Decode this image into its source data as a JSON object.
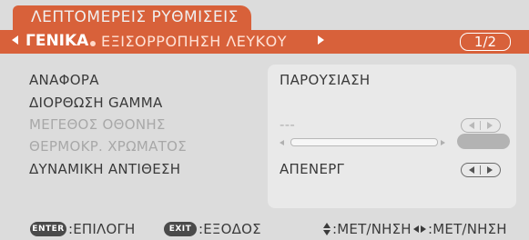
{
  "window": {
    "title": "ΛΕΠΤΟΜΕΡΕΙΣ ΡΥΘΜΙΣΕΙΣ"
  },
  "tabs": {
    "active": "ΓΕΝΙΚΑ",
    "inactive": "ΕΞΙΣΟΡΡΟΠΗΣΗ ΛΕΥΚΟΥ",
    "page": "1/2",
    "left_icon": "triangle-left-icon",
    "right_icon": "triangle-right-icon"
  },
  "settings": [
    {
      "label": "ΑΝΑΦΟΡΑ",
      "value": "ΠΑΡΟΥΣΙΑΣΗ",
      "enabled": true
    },
    {
      "label": "ΔΙΟΡΘΩΣΗ GAMMA",
      "value": "",
      "enabled": true
    },
    {
      "label": "ΜΕΓΕΘΟΣ ΟΘΟΝΗΣ",
      "value": "---",
      "enabled": false
    },
    {
      "label": "ΘΕΡΜΟΚΡ. ΧΡΩΜΑΤΟΣ",
      "value": "",
      "enabled": false
    },
    {
      "label": "ΔΥΝΑΜΙΚΗ ΑΝΤΙΘΕΣΗ",
      "value": "ΑΠΕΝΕΡΓ",
      "enabled": true
    }
  ],
  "footer": {
    "enter_key": "ENTER",
    "enter_text": ":ΕΠΙΛΟΓΗ",
    "exit_key": "EXIT",
    "exit_text": ":ΕΞΟΔΟΣ",
    "updown_text": ":ΜΕΤ/ΝΗΣΗ",
    "leftright_text": ":ΜΕΤ/ΝΗΣΗ"
  },
  "colors": {
    "accent": "#d8613a",
    "panel": "#dcdcdc",
    "value_area": "#e9e9e9",
    "text": "#3a3a3a",
    "disabled_text": "#a8a8a8"
  }
}
